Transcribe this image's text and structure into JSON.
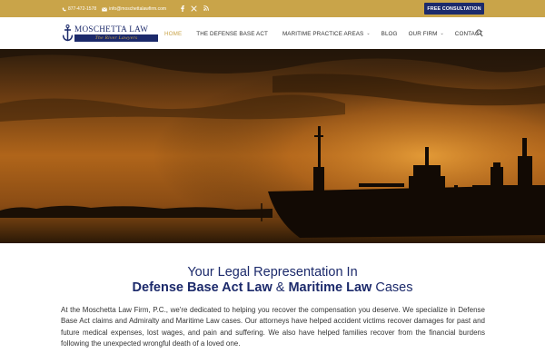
{
  "topbar": {
    "phone": "877-472-1578",
    "email": "info@moschettalawfirm.com",
    "social_icons": [
      "facebook-icon",
      "x-twitter-icon",
      "rss-icon"
    ],
    "consult_label": "FREE CONSULTATION"
  },
  "logo": {
    "name": "MOSCHETTA LAW",
    "tagline": "The River Lawyers"
  },
  "nav": {
    "items": [
      {
        "label": "HOME",
        "active": true
      },
      {
        "label": "THE DEFENSE BASE ACT"
      },
      {
        "label": "MARITIME PRACTICE AREAS",
        "caret": "⌄"
      },
      {
        "label": "BLOG"
      },
      {
        "label": "OUR FIRM",
        "caret": "⌄"
      },
      {
        "label": "CONTACT"
      }
    ]
  },
  "hero": {
    "slides_total": 2,
    "active_slide": 1
  },
  "intro": {
    "line1": "Your Legal Representation In",
    "line2_a": "Defense Base Act Law",
    "line2_amp": " & ",
    "line2_b": "Maritime Law",
    "line2_c": " Cases"
  },
  "body": {
    "paragraph": "At the Moschetta Law Firm, P.C., we're dedicated to helping you recover the compensation you deserve. We specialize in Defense Base Act claims and Admiralty and Maritime Law cases. Our attorneys have helped accident victims recover damages for past and future medical expenses, lost wages, and pain and suffering. We also have helped families recover from the financial burdens following the unexpected wrongful death of a loved one."
  },
  "colors": {
    "gold": "#c9a449",
    "navy": "#1c2a6b"
  }
}
